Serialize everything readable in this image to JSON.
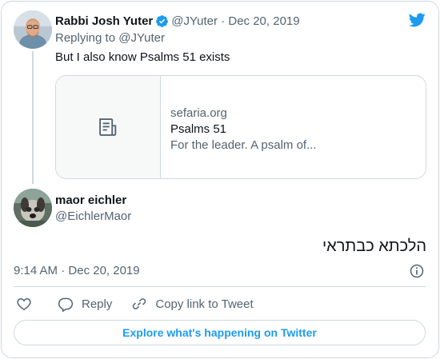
{
  "parent_tweet": {
    "author_name": "Rabbi Josh Yuter",
    "author_handle": "@JYuter",
    "date": "Dec 20, 2019",
    "replying_to_prefix": "Replying to",
    "replying_to_handle": "@JYuter",
    "text": "But I also know Psalms 51 exists",
    "link_card": {
      "domain": "sefaria.org",
      "title": "Psalms 51",
      "description": "For the leader. A psalm of...",
      "thumbnail_icon": "document-icon"
    }
  },
  "main_tweet": {
    "author_name": "maor eichler",
    "author_handle": "@EichlerMaor",
    "text": "הלכתא כבתראי",
    "time": "9:14 AM",
    "date": "Dec 20, 2019"
  },
  "actions": {
    "like_icon": "heart-icon",
    "reply_label": "Reply",
    "copy_link_label": "Copy link to Tweet"
  },
  "explore_button_label": "Explore what's happening on Twitter",
  "colors": {
    "brand_blue": "#1d9bf0",
    "text_primary": "#0f1419",
    "text_secondary": "#536471",
    "border": "#cfd9de"
  }
}
